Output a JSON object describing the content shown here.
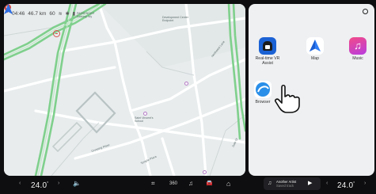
{
  "status_bar": {
    "time": "04:46",
    "speed": "46.7 km",
    "extra": "60"
  },
  "map": {
    "labels": {
      "top_road": "PASSENGER\nDelivery Wy",
      "dev_center": "Development Center\nEndpoint",
      "northwest_lane": "Northwest Lane",
      "saint_vincent": "Saint Vincent's\nSchool",
      "community_center": "Saint Vincent's\nCenter",
      "crossing": "Crossing Place",
      "temple": "Temple Plaza",
      "dale": "Dale Dr"
    }
  },
  "apps": [
    {
      "name": "Real-time VR Assist",
      "icon": "vr-assist-icon"
    },
    {
      "name": "Map",
      "icon": "map-navigation-icon"
    },
    {
      "name": "Music",
      "icon": "music-icon"
    },
    {
      "name": "Browser",
      "icon": "browser-icon"
    }
  ],
  "bottom_bar": {
    "left_temp": "24.0",
    "right_temp": "24.0",
    "degree": "°",
    "chev_left": "‹",
    "chev_right": "›",
    "volume_symbol": "🔈",
    "grid_symbol": "⌗",
    "view360_symbol": "360",
    "music_symbol": "♫",
    "car_symbol": "🚘",
    "home_symbol": "⌂",
    "media_symbol": "♫",
    "play_symbol": "▶",
    "now_playing_title": "Another Artist",
    "now_playing_sub": "Saved track"
  }
}
